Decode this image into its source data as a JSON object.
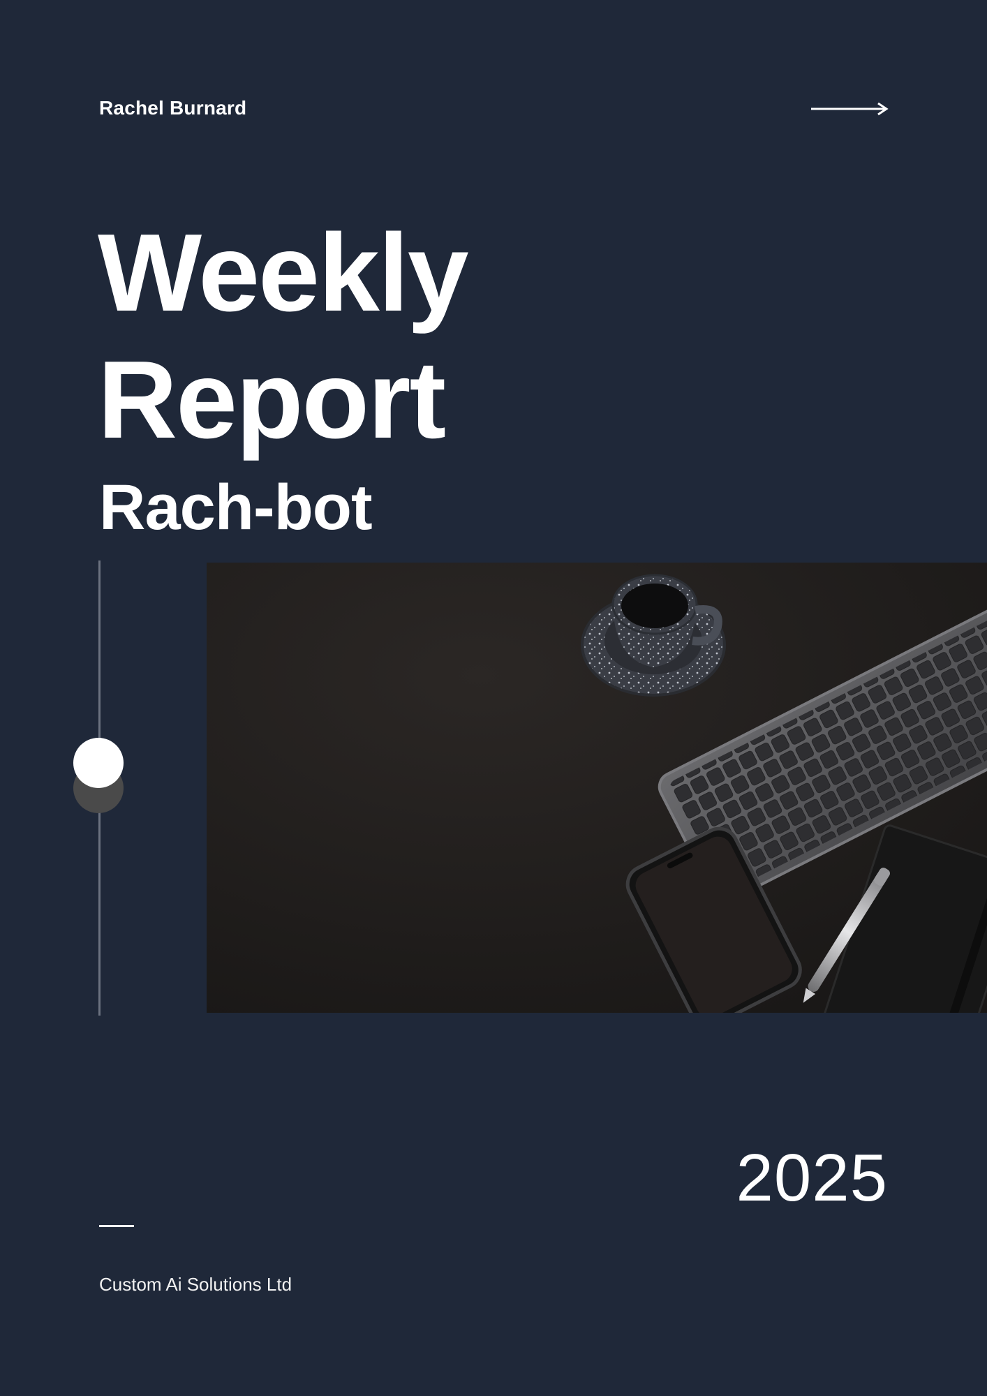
{
  "header": {
    "author": "Rachel Burnard",
    "arrow_icon": "arrow-right-icon"
  },
  "cover": {
    "title_line1": "Weekly",
    "title_line2": "Report",
    "subtitle": "Rach-bot"
  },
  "footer": {
    "year": "2025",
    "company": "Custom Ai Solutions Ltd"
  },
  "colors": {
    "background": "#1f2839",
    "text": "#ffffff",
    "photo_background": "#201e1d"
  }
}
